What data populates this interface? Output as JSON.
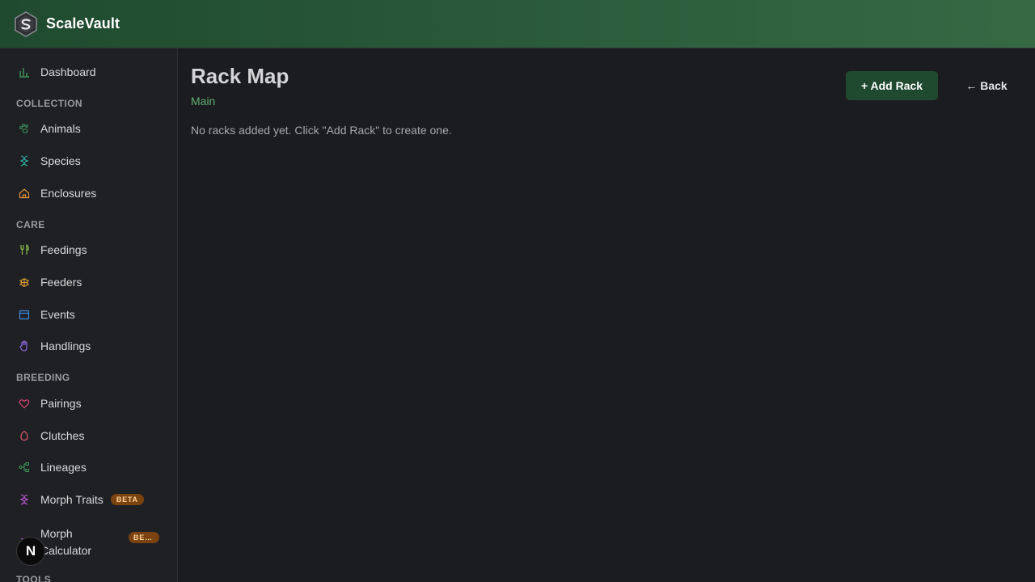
{
  "app": {
    "brand": "ScaleVault"
  },
  "sidebar": {
    "dashboard": "Dashboard",
    "sections": {
      "collection": "COLLECTION",
      "care": "CARE",
      "breeding": "BREEDING",
      "tools": "TOOLS"
    },
    "items": {
      "animals": "Animals",
      "species": "Species",
      "enclosures": "Enclosures",
      "feedings": "Feedings",
      "feeders": "Feeders",
      "events": "Events",
      "handlings": "Handlings",
      "pairings": "Pairings",
      "clutches": "Clutches",
      "lineages": "Lineages",
      "morph_traits": "Morph Traits",
      "morph_calc_line1": "Morph",
      "morph_calc_line2": "Calculator"
    },
    "badges": {
      "beta": "BETA",
      "beta_truncated": "BE…"
    }
  },
  "main": {
    "title": "Rack Map",
    "subtitle": "Main",
    "empty_message": "No racks added yet. Click \"Add Rack\" to create one.",
    "add_button": "+ Add Rack",
    "back_button": "← Back"
  },
  "overlay": {
    "framework_badge": "N"
  },
  "colors": {
    "accent_green": "#1f4a2f",
    "subtitle_green": "#5fae6f",
    "badge_bg": "#7a4310"
  }
}
